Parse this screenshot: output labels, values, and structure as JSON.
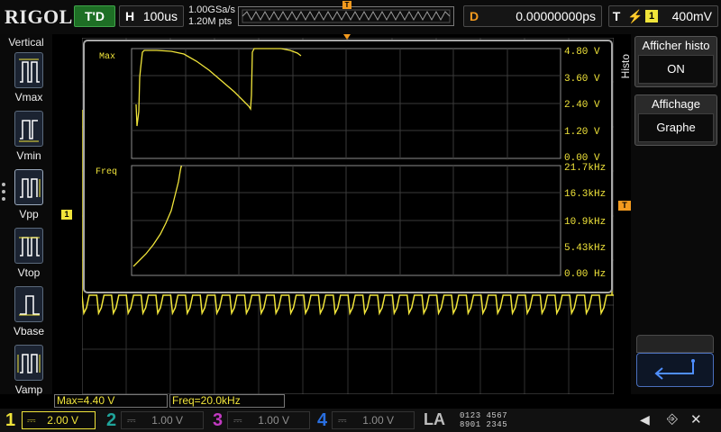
{
  "topbar": {
    "brand": "RIGOL",
    "run_state": "T'D",
    "timebase_key": "H",
    "timebase_value": "100us",
    "sample_rate": "1.00GSa/s",
    "memory_depth": "1.20M pts",
    "trigger_position_marker": "T",
    "delay_key": "D",
    "delay_value": "0.00000000ps",
    "trigger_key": "T",
    "trigger_source": "1",
    "trigger_level": "400mV"
  },
  "left_menu": {
    "title": "Vertical",
    "items": [
      "Vmax",
      "Vmin",
      "Vpp",
      "Vtop",
      "Vbase",
      "Vamp"
    ],
    "icons": [
      "vmax-icon",
      "vmin-icon",
      "vpp-icon",
      "vtop-icon",
      "vbase-icon",
      "vamp-icon"
    ]
  },
  "markers": {
    "ch1": "1",
    "trigger_level": "T"
  },
  "histogram": {
    "top_graph": {
      "label": "Max",
      "ticks": [
        "4.80 V",
        "3.60 V",
        "2.40 V",
        "1.20 V",
        "0.00 V"
      ]
    },
    "bottom_graph": {
      "label": "Freq",
      "ticks": [
        "21.7kHz",
        "16.3kHz",
        "10.9kHz",
        "5.43kHz",
        "0.00 Hz"
      ]
    }
  },
  "right_menu": {
    "side_tab": "Histo",
    "softkeys": [
      {
        "title": "Afficher histo",
        "value": "ON"
      },
      {
        "title": "Affichage",
        "value": "Graphe"
      }
    ],
    "return_icon": "return-arrow-icon"
  },
  "readouts": {
    "max": "Max=4.40 V",
    "freq": "Freq=20.0kHz"
  },
  "channels": [
    {
      "num": "1",
      "scale": "2.00 V",
      "color": "#f0e43a",
      "active": true
    },
    {
      "num": "2",
      "scale": "1.00 V",
      "color": "#1fa39a",
      "active": false
    },
    {
      "num": "3",
      "scale": "1.00 V",
      "color": "#c23ac2",
      "active": false
    },
    {
      "num": "4",
      "scale": "1.00 V",
      "color": "#2a6fe0",
      "active": false
    }
  ],
  "logic": {
    "label": "LA",
    "row1": "0123 4567",
    "row2": "8901 2345"
  },
  "status_icons": [
    "speaker-icon",
    "usb-icon",
    "mute-icon"
  ]
}
